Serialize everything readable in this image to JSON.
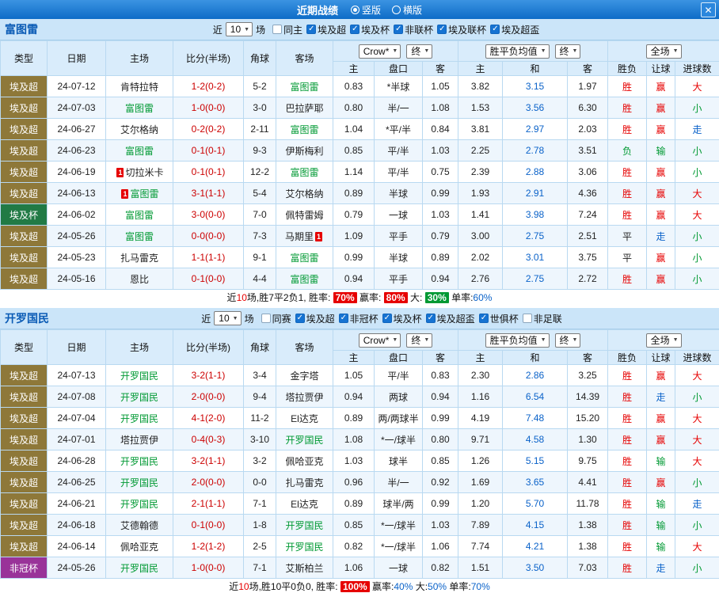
{
  "palette": {
    "red": "#e60000",
    "green": "#009933",
    "blue": "#0a62c9",
    "black": "#222222",
    "score": "#cc0000",
    "team": "#009933",
    "draw": "#0a62c9",
    "type_super": "#8e7839",
    "type_cup": "#217a45",
    "type_caf": "#993399",
    "header_bg": "#d9ecfb",
    "teamrow_bg": "#cbe5f9",
    "border": "#b9d9f1"
  },
  "topbar": {
    "title": "近期战绩",
    "radio_vertical": "竖版",
    "radio_horizontal": "横版",
    "close": "✕"
  },
  "sections": [
    {
      "team": "富图雷",
      "filters": {
        "near": "近",
        "count": "10",
        "games": "场",
        "checkboxes": [
          {
            "label": "同主",
            "checked": false
          },
          {
            "label": "埃及超",
            "checked": true
          },
          {
            "label": "埃及杯",
            "checked": true
          },
          {
            "label": "非联杯",
            "checked": true
          },
          {
            "label": "埃及联杯",
            "checked": true
          },
          {
            "label": "埃及超盃",
            "checked": true
          }
        ]
      },
      "header": {
        "type": "类型",
        "date": "日期",
        "home": "主场",
        "score": "比分(半场)",
        "corner": "角球",
        "away": "客场",
        "company_select": "Crow*",
        "company_state": "终",
        "odds_home": "主",
        "odds_line": "盘口",
        "odds_away": "客",
        "avg_select": "胜平负均值",
        "avg_state": "终",
        "avg_home": "主",
        "avg_draw": "和",
        "avg_away": "客",
        "scope_select": "全场",
        "result": "胜负",
        "handicap": "让球",
        "goals": "进球数"
      },
      "rows": [
        {
          "type": [
            "埃及超",
            "type_super"
          ],
          "date": "24-07-12",
          "home": {
            "t": "肯特拉特"
          },
          "score": "1-2(0-2)",
          "corner": "5-2",
          "away": {
            "t": "富图雷",
            "c": "team"
          },
          "odds": [
            "0.83",
            "*半球",
            "1.05"
          ],
          "avg": [
            "3.82",
            "3.15",
            "1.97"
          ],
          "res": [
            "胜",
            "red"
          ],
          "let": [
            "赢",
            "red"
          ],
          "goal": [
            "大",
            "red"
          ]
        },
        {
          "type": [
            "埃及超",
            "type_super"
          ],
          "date": "24-07-03",
          "home": {
            "t": "富图雷",
            "c": "team"
          },
          "score": "1-0(0-0)",
          "corner": "3-0",
          "away": {
            "t": "巴拉萨耶"
          },
          "odds": [
            "0.80",
            "半/一",
            "1.08"
          ],
          "avg": [
            "1.53",
            "3.56",
            "6.30"
          ],
          "res": [
            "胜",
            "red"
          ],
          "let": [
            "赢",
            "red"
          ],
          "goal": [
            "小",
            "green"
          ]
        },
        {
          "type": [
            "埃及超",
            "type_super"
          ],
          "date": "24-06-27",
          "home": {
            "t": "艾尔格纳"
          },
          "score": "0-2(0-2)",
          "corner": "2-11",
          "away": {
            "t": "富图雷",
            "c": "team"
          },
          "odds": [
            "1.04",
            "*平/半",
            "0.84"
          ],
          "avg": [
            "3.81",
            "2.97",
            "2.03"
          ],
          "res": [
            "胜",
            "red"
          ],
          "let": [
            "赢",
            "red"
          ],
          "goal": [
            "走",
            "blue"
          ]
        },
        {
          "type": [
            "埃及超",
            "type_super"
          ],
          "date": "24-06-23",
          "home": {
            "t": "富图雷",
            "c": "team"
          },
          "score": "0-1(0-1)",
          "corner": "9-3",
          "away": {
            "t": "伊斯梅利"
          },
          "odds": [
            "0.85",
            "平/半",
            "1.03"
          ],
          "avg": [
            "2.25",
            "2.78",
            "3.51"
          ],
          "res": [
            "负",
            "green"
          ],
          "let": [
            "输",
            "green"
          ],
          "goal": [
            "小",
            "green"
          ]
        },
        {
          "type": [
            "埃及超",
            "type_super"
          ],
          "date": "24-06-19",
          "home": {
            "t": "切拉米卡",
            "bb": "1"
          },
          "score": "0-1(0-1)",
          "corner": "12-2",
          "away": {
            "t": "富图雷",
            "c": "team"
          },
          "odds": [
            "1.14",
            "平/半",
            "0.75"
          ],
          "avg": [
            "2.39",
            "2.88",
            "3.06"
          ],
          "res": [
            "胜",
            "red"
          ],
          "let": [
            "赢",
            "red"
          ],
          "goal": [
            "小",
            "green"
          ]
        },
        {
          "type": [
            "埃及超",
            "type_super"
          ],
          "date": "24-06-13",
          "home": {
            "t": "富图雷",
            "c": "team",
            "bb": "1"
          },
          "score": "3-1(1-1)",
          "corner": "5-4",
          "away": {
            "t": "艾尔格纳"
          },
          "odds": [
            "0.89",
            "半球",
            "0.99"
          ],
          "avg": [
            "1.93",
            "2.91",
            "4.36"
          ],
          "res": [
            "胜",
            "red"
          ],
          "let": [
            "赢",
            "red"
          ],
          "goal": [
            "大",
            "red"
          ]
        },
        {
          "type": [
            "埃及杯",
            "type_cup"
          ],
          "date": "24-06-02",
          "home": {
            "t": "富图雷",
            "c": "team"
          },
          "score": "3-0(0-0)",
          "corner": "7-0",
          "away": {
            "t": "佩特雷姆"
          },
          "odds": [
            "0.79",
            "一球",
            "1.03"
          ],
          "avg": [
            "1.41",
            "3.98",
            "7.24"
          ],
          "res": [
            "胜",
            "red"
          ],
          "let": [
            "赢",
            "red"
          ],
          "goal": [
            "大",
            "red"
          ]
        },
        {
          "type": [
            "埃及超",
            "type_super"
          ],
          "date": "24-05-26",
          "home": {
            "t": "富图雷",
            "c": "team"
          },
          "score": "0-0(0-0)",
          "corner": "7-3",
          "away": {
            "t": "马期里",
            "ba": "1"
          },
          "odds": [
            "1.09",
            "平手",
            "0.79"
          ],
          "avg": [
            "3.00",
            "2.75",
            "2.51"
          ],
          "res": [
            "平",
            "black"
          ],
          "let": [
            "走",
            "blue"
          ],
          "goal": [
            "小",
            "green"
          ]
        },
        {
          "type": [
            "埃及超",
            "type_super"
          ],
          "date": "24-05-23",
          "home": {
            "t": "扎马雷克"
          },
          "score": "1-1(1-1)",
          "corner": "9-1",
          "away": {
            "t": "富图雷",
            "c": "team"
          },
          "odds": [
            "0.99",
            "半球",
            "0.89"
          ],
          "avg": [
            "2.02",
            "3.01",
            "3.75"
          ],
          "res": [
            "平",
            "black"
          ],
          "let": [
            "赢",
            "red"
          ],
          "goal": [
            "小",
            "green"
          ]
        },
        {
          "type": [
            "埃及超",
            "type_super"
          ],
          "date": "24-05-16",
          "home": {
            "t": "恩比"
          },
          "score": "0-1(0-0)",
          "corner": "4-4",
          "away": {
            "t": "富图雷",
            "c": "team"
          },
          "odds": [
            "0.94",
            "平手",
            "0.94"
          ],
          "avg": [
            "2.76",
            "2.75",
            "2.72"
          ],
          "res": [
            "胜",
            "red"
          ],
          "let": [
            "赢",
            "red"
          ],
          "goal": [
            "小",
            "green"
          ]
        }
      ],
      "summary": [
        {
          "text": "近"
        },
        {
          "text": "10",
          "c": "red"
        },
        {
          "text": "场,胜7平2负1, 胜率: "
        },
        {
          "text": "70%",
          "bg": "red"
        },
        {
          "text": " 赢率: "
        },
        {
          "text": "80%",
          "bg": "red"
        },
        {
          "text": " 大: "
        },
        {
          "text": "30%",
          "bg": "green"
        },
        {
          "text": " 单率:"
        },
        {
          "text": "60%",
          "c": "blue"
        }
      ]
    },
    {
      "team": "开罗国民",
      "filters": {
        "near": "近",
        "count": "10",
        "games": "场",
        "checkboxes": [
          {
            "label": "同赛",
            "checked": false
          },
          {
            "label": "埃及超",
            "checked": true
          },
          {
            "label": "非冠杯",
            "checked": true
          },
          {
            "label": "埃及杯",
            "checked": true
          },
          {
            "label": "埃及超盃",
            "checked": true
          },
          {
            "label": "世俱杯",
            "checked": true
          },
          {
            "label": "非足联",
            "checked": false
          }
        ]
      },
      "header": {
        "type": "类型",
        "date": "日期",
        "home": "主场",
        "score": "比分(半场)",
        "corner": "角球",
        "away": "客场",
        "company_select": "Crow*",
        "company_state": "终",
        "odds_home": "主",
        "odds_line": "盘口",
        "odds_away": "客",
        "avg_select": "胜平负均值",
        "avg_state": "终",
        "avg_home": "主",
        "avg_draw": "和",
        "avg_away": "客",
        "scope_select": "全场",
        "result": "胜负",
        "handicap": "让球",
        "goals": "进球数"
      },
      "rows": [
        {
          "type": [
            "埃及超",
            "type_super"
          ],
          "date": "24-07-13",
          "home": {
            "t": "开罗国民",
            "c": "team"
          },
          "score": "3-2(1-1)",
          "corner": "3-4",
          "away": {
            "t": "金字塔"
          },
          "odds": [
            "1.05",
            "平/半",
            "0.83"
          ],
          "avg": [
            "2.30",
            "2.86",
            "3.25"
          ],
          "res": [
            "胜",
            "red"
          ],
          "let": [
            "赢",
            "red"
          ],
          "goal": [
            "大",
            "red"
          ]
        },
        {
          "type": [
            "埃及超",
            "type_super"
          ],
          "date": "24-07-08",
          "home": {
            "t": "开罗国民",
            "c": "team"
          },
          "score": "2-0(0-0)",
          "corner": "9-4",
          "away": {
            "t": "塔拉贾伊"
          },
          "odds": [
            "0.94",
            "两球",
            "0.94"
          ],
          "avg": [
            "1.16",
            "6.54",
            "14.39"
          ],
          "res": [
            "胜",
            "red"
          ],
          "let": [
            "走",
            "blue"
          ],
          "goal": [
            "小",
            "green"
          ]
        },
        {
          "type": [
            "埃及超",
            "type_super"
          ],
          "date": "24-07-04",
          "home": {
            "t": "开罗国民",
            "c": "team"
          },
          "score": "4-1(2-0)",
          "corner": "11-2",
          "away": {
            "t": "El达克"
          },
          "odds": [
            "0.89",
            "两/两球半",
            "0.99"
          ],
          "avg": [
            "4.19",
            "7.48",
            "15.20"
          ],
          "res": [
            "胜",
            "red"
          ],
          "let": [
            "赢",
            "red"
          ],
          "goal": [
            "大",
            "red"
          ]
        },
        {
          "type": [
            "埃及超",
            "type_super"
          ],
          "date": "24-07-01",
          "home": {
            "t": "塔拉贾伊"
          },
          "score": "0-4(0-3)",
          "corner": "3-10",
          "away": {
            "t": "开罗国民",
            "c": "team"
          },
          "odds": [
            "1.08",
            "*一/球半",
            "0.80"
          ],
          "avg": [
            "9.71",
            "4.58",
            "1.30"
          ],
          "res": [
            "胜",
            "red"
          ],
          "let": [
            "赢",
            "red"
          ],
          "goal": [
            "大",
            "red"
          ]
        },
        {
          "type": [
            "埃及超",
            "type_super"
          ],
          "date": "24-06-28",
          "home": {
            "t": "开罗国民",
            "c": "team"
          },
          "score": "3-2(1-1)",
          "corner": "3-2",
          "away": {
            "t": "佩哈亚克"
          },
          "odds": [
            "1.03",
            "球半",
            "0.85"
          ],
          "avg": [
            "1.26",
            "5.15",
            "9.75"
          ],
          "res": [
            "胜",
            "red"
          ],
          "let": [
            "输",
            "green"
          ],
          "goal": [
            "大",
            "red"
          ]
        },
        {
          "type": [
            "埃及超",
            "type_super"
          ],
          "date": "24-06-25",
          "home": {
            "t": "开罗国民",
            "c": "team"
          },
          "score": "2-0(0-0)",
          "corner": "0-0",
          "away": {
            "t": "扎马雷克"
          },
          "odds": [
            "0.96",
            "半/一",
            "0.92"
          ],
          "avg": [
            "1.69",
            "3.65",
            "4.41"
          ],
          "res": [
            "胜",
            "red"
          ],
          "let": [
            "赢",
            "red"
          ],
          "goal": [
            "小",
            "green"
          ]
        },
        {
          "type": [
            "埃及超",
            "type_super"
          ],
          "date": "24-06-21",
          "home": {
            "t": "开罗国民",
            "c": "team"
          },
          "score": "2-1(1-1)",
          "corner": "7-1",
          "away": {
            "t": "El达克"
          },
          "odds": [
            "0.89",
            "球半/两",
            "0.99"
          ],
          "avg": [
            "1.20",
            "5.70",
            "11.78"
          ],
          "res": [
            "胜",
            "red"
          ],
          "let": [
            "输",
            "green"
          ],
          "goal": [
            "走",
            "blue"
          ]
        },
        {
          "type": [
            "埃及超",
            "type_super"
          ],
          "date": "24-06-18",
          "home": {
            "t": "艾德翰德"
          },
          "score": "0-1(0-0)",
          "corner": "1-8",
          "away": {
            "t": "开罗国民",
            "c": "team"
          },
          "odds": [
            "0.85",
            "*一/球半",
            "1.03"
          ],
          "avg": [
            "7.89",
            "4.15",
            "1.38"
          ],
          "res": [
            "胜",
            "red"
          ],
          "let": [
            "输",
            "green"
          ],
          "goal": [
            "小",
            "green"
          ]
        },
        {
          "type": [
            "埃及超",
            "type_super"
          ],
          "date": "24-06-14",
          "home": {
            "t": "佩哈亚克"
          },
          "score": "1-2(1-2)",
          "corner": "2-5",
          "away": {
            "t": "开罗国民",
            "c": "team"
          },
          "odds": [
            "0.82",
            "*一/球半",
            "1.06"
          ],
          "avg": [
            "7.74",
            "4.21",
            "1.38"
          ],
          "res": [
            "胜",
            "red"
          ],
          "let": [
            "输",
            "green"
          ],
          "goal": [
            "大",
            "red"
          ]
        },
        {
          "type": [
            "非冠杯",
            "type_caf"
          ],
          "date": "24-05-26",
          "home": {
            "t": "开罗国民",
            "c": "team"
          },
          "score": "1-0(0-0)",
          "corner": "7-1",
          "away": {
            "t": "艾斯柏兰"
          },
          "odds": [
            "1.06",
            "一球",
            "0.82"
          ],
          "avg": [
            "1.51",
            "3.50",
            "7.03"
          ],
          "res": [
            "胜",
            "red"
          ],
          "let": [
            "走",
            "blue"
          ],
          "goal": [
            "小",
            "green"
          ]
        }
      ],
      "summary": [
        {
          "text": "近"
        },
        {
          "text": "10",
          "c": "red"
        },
        {
          "text": "场,胜10平0负0, 胜率: "
        },
        {
          "text": "100%",
          "bg": "red"
        },
        {
          "text": " 赢率:"
        },
        {
          "text": "40%",
          "c": "blue"
        },
        {
          "text": " 大:"
        },
        {
          "text": "50%",
          "c": "blue"
        },
        {
          "text": " 单率:"
        },
        {
          "text": "70%",
          "c": "blue"
        }
      ]
    }
  ]
}
